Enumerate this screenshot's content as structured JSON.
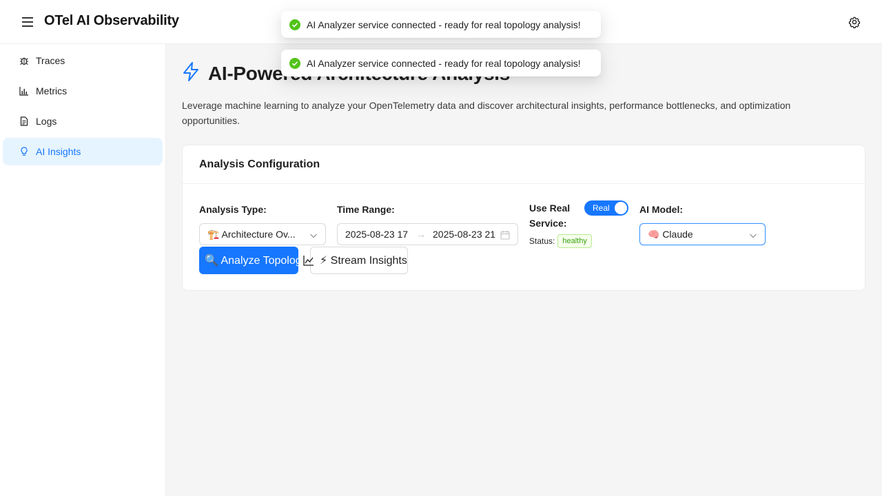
{
  "header": {
    "title": "OTel AI Observability",
    "menu_icon": "hamburger-icon",
    "settings_icon": "gear-icon"
  },
  "sidebar": {
    "items": [
      {
        "label": "Traces",
        "icon": "bug-icon",
        "active": false
      },
      {
        "label": "Metrics",
        "icon": "bar-chart-icon",
        "active": false
      },
      {
        "label": "Logs",
        "icon": "file-text-icon",
        "active": false
      },
      {
        "label": "AI Insights",
        "icon": "bulb-icon",
        "active": true
      }
    ]
  },
  "page": {
    "title": "AI-Powered Architecture Analysis",
    "description": "Leverage machine learning to analyze your OpenTelemetry data and discover architectural insights, performance bottlenecks, and optimization opportunities."
  },
  "config": {
    "card_title": "Analysis Configuration",
    "analysis_type_label": "Analysis Type:",
    "analysis_type_value": "🏗️ Architecture Ov...",
    "time_range_label": "Time Range:",
    "time_range_from": "2025-08-23 17",
    "time_range_to": "2025-08-23 21",
    "use_real_service_label": "Use Real Service:",
    "toggle_label": "Real",
    "toggle_on": true,
    "status_label": "Status:",
    "status_value": "healthy",
    "ai_model_label": "AI Model:",
    "ai_model_value": "🧠 Claude",
    "analyze_button": "🔍 Analyze Topology",
    "stream_button": "⚡ Stream Insights"
  },
  "toasts": [
    {
      "message": "AI Analyzer service connected - ready for real topology analysis!",
      "icon": "check-circle-icon"
    },
    {
      "message": "AI Analyzer service connected - ready for real topology analysis!",
      "icon": "check-circle-icon"
    }
  ],
  "colors": {
    "accent": "#1677ff",
    "success": "#52c41a",
    "active_bg": "#e6f4ff"
  }
}
